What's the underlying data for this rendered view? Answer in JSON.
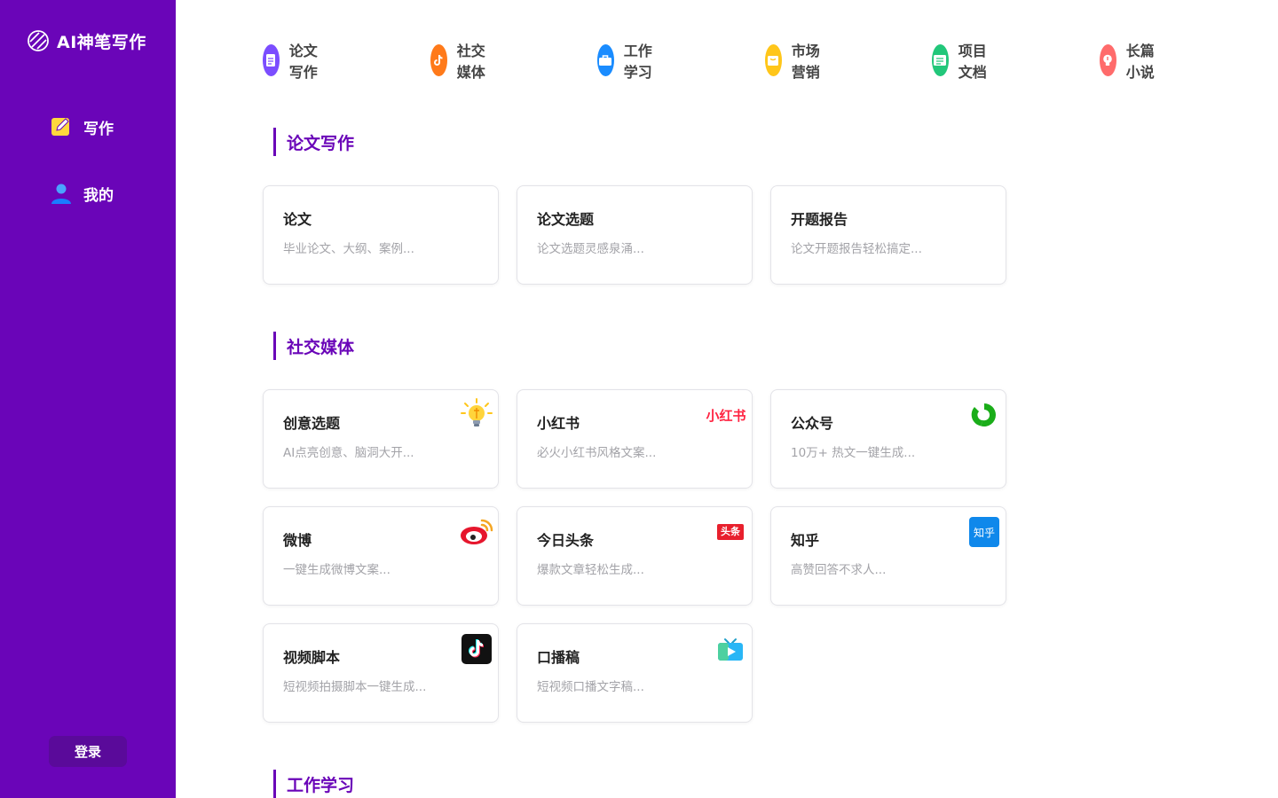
{
  "brand": {
    "title": "AI神笔写作"
  },
  "sidebar": {
    "items": [
      {
        "label": "写作",
        "icon": "pencil-note-icon"
      },
      {
        "label": "我的",
        "icon": "user-icon"
      }
    ],
    "login_label": "登录"
  },
  "categories": [
    {
      "label": "论文写作",
      "icon": "document-icon",
      "color": "#7b4dff"
    },
    {
      "label": "社交媒体",
      "icon": "tiktok-icon",
      "color": "#ff7a1a"
    },
    {
      "label": "工作学习",
      "icon": "briefcase-icon",
      "color": "#1a8cff"
    },
    {
      "label": "市场营销",
      "icon": "shopping-bag-icon",
      "color": "#ffc61a"
    },
    {
      "label": "项目文档",
      "icon": "folder-list-icon",
      "color": "#22c77a"
    },
    {
      "label": "长篇小说",
      "icon": "lightbulb-icon",
      "color": "#ff6b6b"
    }
  ],
  "sections": [
    {
      "title": "论文写作",
      "cards": [
        {
          "title": "论文",
          "desc": "毕业论文、大纲、案例..."
        },
        {
          "title": "论文选题",
          "desc": "论文选题灵感泉涌..."
        },
        {
          "title": "开题报告",
          "desc": "论文开题报告轻松搞定..."
        }
      ]
    },
    {
      "title": "社交媒体",
      "cards": [
        {
          "title": "创意选题",
          "desc": "AI点亮创意、脑洞大开...",
          "badge": "lightbulb-icon"
        },
        {
          "title": "小红书",
          "desc": "必火小红书风格文案...",
          "badge": "xiaohongshu-logo",
          "badge_text": "小红书"
        },
        {
          "title": "公众号",
          "desc": "10万+ 热文一键生成...",
          "badge": "wechat-official-account-icon"
        },
        {
          "title": "微博",
          "desc": "一键生成微博文案...",
          "badge": "weibo-icon"
        },
        {
          "title": "今日头条",
          "desc": "爆款文章轻松生成...",
          "badge": "toutiao-logo",
          "badge_text": "头条"
        },
        {
          "title": "知乎",
          "desc": "高赞回答不求人...",
          "badge": "zhihu-logo",
          "badge_text": "知乎"
        },
        {
          "title": "视频脚本",
          "desc": "短视频拍摄脚本一键生成...",
          "badge": "tiktok-icon"
        },
        {
          "title": "口播稿",
          "desc": "短视频口播文字稿...",
          "badge": "video-tv-icon"
        }
      ]
    },
    {
      "title": "工作学习",
      "cards": []
    }
  ],
  "colors": {
    "sidebar_bg": "#6a05b8",
    "accent": "#6a05b8",
    "login_bg": "#5a0a9a"
  }
}
